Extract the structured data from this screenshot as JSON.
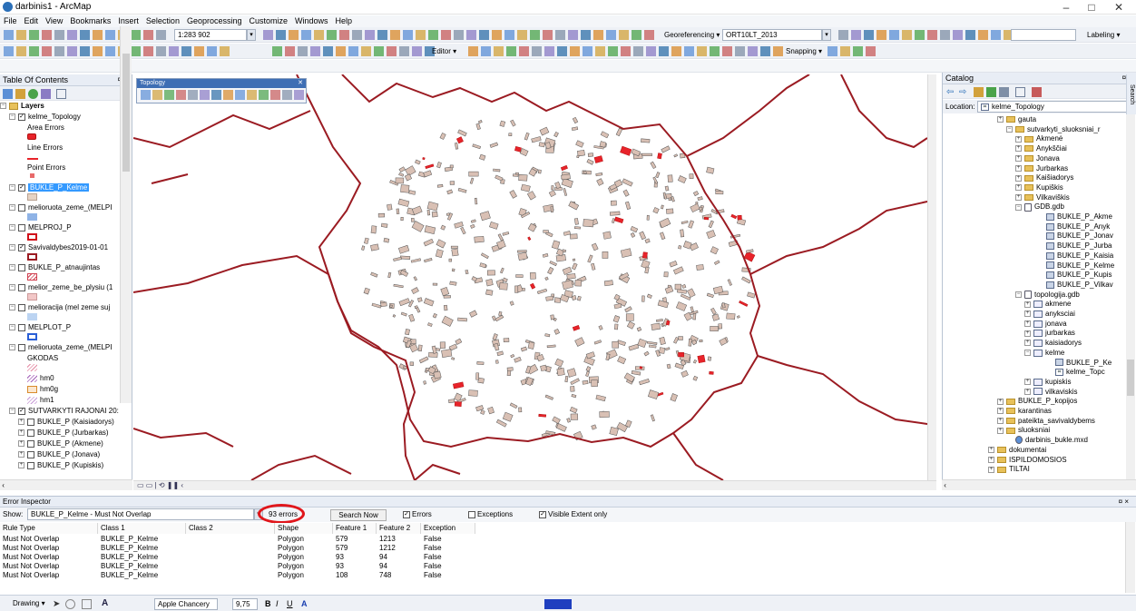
{
  "window": {
    "title": "darbinis1 - ArcMap",
    "controls": [
      "–",
      "□",
      "✕"
    ]
  },
  "menu": [
    "File",
    "Edit",
    "View",
    "Bookmarks",
    "Insert",
    "Selection",
    "Geoprocessing",
    "Customize",
    "Windows",
    "Help"
  ],
  "toolbars": {
    "scale": "1:283 902",
    "georeferencing_label": "Georeferencing ▾",
    "georeferencing_layer": "ORT10LT_2013",
    "labeling_label": "Labeling ▾",
    "editor_label": "Editor ▾",
    "snapping_label": "Snapping ▾"
  },
  "toc": {
    "title": "Table Of Contents",
    "pin": "¤ ×",
    "rows": [
      {
        "indent": 0,
        "exp": "−",
        "icon": "layers",
        "check": null,
        "label": "Layers",
        "bold": true
      },
      {
        "indent": 10,
        "exp": "−",
        "icon": null,
        "check": "✓",
        "label": "kelme_Topology"
      },
      {
        "indent": 30,
        "exp": null,
        "icon": null,
        "check": null,
        "label": "Area Errors"
      },
      {
        "indent": 30,
        "exp": null,
        "icon": null,
        "check": null,
        "label": "",
        "swatch": "area-error"
      },
      {
        "indent": 30,
        "exp": null,
        "icon": null,
        "check": null,
        "label": "Line Errors"
      },
      {
        "indent": 30,
        "exp": null,
        "icon": null,
        "check": null,
        "label": "",
        "swatch": "line-error"
      },
      {
        "indent": 30,
        "exp": null,
        "icon": null,
        "check": null,
        "label": "Point Errors"
      },
      {
        "indent": 30,
        "exp": null,
        "icon": null,
        "check": null,
        "label": "",
        "swatch": "point-error"
      },
      {
        "indent": 10,
        "exp": "−",
        "icon": null,
        "check": "✓",
        "label": "BUKLE_P_Kelme",
        "selected": true
      },
      {
        "indent": 30,
        "exp": null,
        "icon": null,
        "check": null,
        "label": "",
        "swatch": "bukle"
      },
      {
        "indent": 10,
        "exp": "−",
        "icon": null,
        "check": "",
        "label": "melioruota_zeme_(MELPI"
      },
      {
        "indent": 30,
        "exp": null,
        "icon": null,
        "check": null,
        "label": "",
        "swatch": "blue-fill"
      },
      {
        "indent": 10,
        "exp": "−",
        "icon": null,
        "check": "",
        "label": "MELPROJ_P"
      },
      {
        "indent": 30,
        "exp": null,
        "icon": null,
        "check": null,
        "label": "",
        "swatch": "red-outline"
      },
      {
        "indent": 10,
        "exp": "−",
        "icon": null,
        "check": "✓",
        "label": "Savivaldybes2019-01-01"
      },
      {
        "indent": 30,
        "exp": null,
        "icon": null,
        "check": null,
        "label": "",
        "swatch": "darkred-outline"
      },
      {
        "indent": 10,
        "exp": "−",
        "icon": null,
        "check": "",
        "label": "BUKLE_P_atnaujintas"
      },
      {
        "indent": 30,
        "exp": null,
        "icon": null,
        "check": null,
        "label": "",
        "swatch": "hatch-red"
      },
      {
        "indent": 10,
        "exp": "−",
        "icon": null,
        "check": "",
        "label": "melior_zeme_be_plysiu (1"
      },
      {
        "indent": 30,
        "exp": null,
        "icon": null,
        "check": null,
        "label": "",
        "swatch": "pink-fill"
      },
      {
        "indent": 10,
        "exp": "−",
        "icon": null,
        "check": "",
        "label": "melioracija (mel zeme suj"
      },
      {
        "indent": 30,
        "exp": null,
        "icon": null,
        "check": null,
        "label": "",
        "swatch": "lightblue-fill"
      },
      {
        "indent": 10,
        "exp": "−",
        "icon": null,
        "check": "",
        "label": "MELPLOT_P"
      },
      {
        "indent": 30,
        "exp": null,
        "icon": null,
        "check": null,
        "label": "",
        "swatch": "blue-outline"
      },
      {
        "indent": 10,
        "exp": "−",
        "icon": null,
        "check": "",
        "label": "melioruota_zeme_(MELPI"
      },
      {
        "indent": 30,
        "exp": null,
        "icon": null,
        "check": null,
        "label": "GKODAS"
      },
      {
        "indent": 30,
        "exp": null,
        "icon": null,
        "check": null,
        "label": "",
        "swatch": "hatch-pink"
      },
      {
        "indent": 30,
        "exp": null,
        "icon": null,
        "check": null,
        "label": "hm0",
        "swatch_inline": "hatch-purple"
      },
      {
        "indent": 30,
        "exp": null,
        "icon": null,
        "check": null,
        "label": "hm0g",
        "swatch_inline": "orange-box"
      },
      {
        "indent": 30,
        "exp": null,
        "icon": null,
        "check": null,
        "label": "hm1",
        "swatch_inline": "hatch-light"
      },
      {
        "indent": 10,
        "exp": "−",
        "icon": null,
        "check": "✓",
        "label": "SUTVARKYTI RAJONAI 20:"
      },
      {
        "indent": 20,
        "exp": "+",
        "icon": null,
        "check": "",
        "label": "BUKLE_P (Kaisiadorys)"
      },
      {
        "indent": 20,
        "exp": "+",
        "icon": null,
        "check": "",
        "label": "BUKLE_P (Jurbarkas)"
      },
      {
        "indent": 20,
        "exp": "+",
        "icon": null,
        "check": "",
        "label": "BUKLE_P (Akmene)"
      },
      {
        "indent": 20,
        "exp": "+",
        "icon": null,
        "check": "",
        "label": "BUKLE_P (Jonava)"
      },
      {
        "indent": 20,
        "exp": "+",
        "icon": null,
        "check": "",
        "label": "BUKLE_P (Kupiskis)"
      }
    ]
  },
  "topology_toolbar": {
    "title": "Topology",
    "close": "✕"
  },
  "catalog": {
    "title": "Catalog",
    "pin": "¤ ×",
    "location_label": "Location:",
    "location_value": "kelme_Topology",
    "side_tab": "Search",
    "rows": [
      {
        "indent": 70,
        "exp": "+",
        "type": "folder",
        "label": "gauta"
      },
      {
        "indent": 80,
        "exp": "−",
        "type": "folder",
        "label": "sutvarkyti_sluoksniai_r"
      },
      {
        "indent": 90,
        "exp": "+",
        "type": "folder",
        "label": "Akmenė"
      },
      {
        "indent": 90,
        "exp": "+",
        "type": "folder",
        "label": "Anykščiai"
      },
      {
        "indent": 90,
        "exp": "+",
        "type": "folder",
        "label": "Jonava"
      },
      {
        "indent": 90,
        "exp": "+",
        "type": "folder",
        "label": "Jurbarkas"
      },
      {
        "indent": 90,
        "exp": "+",
        "type": "folder",
        "label": "Kaišiadorys"
      },
      {
        "indent": 90,
        "exp": "+",
        "type": "folder",
        "label": "Kupiškis"
      },
      {
        "indent": 90,
        "exp": "+",
        "type": "folder",
        "label": "Vilkaviškis"
      },
      {
        "indent": 90,
        "exp": "−",
        "type": "gdb",
        "label": "GDB.gdb"
      },
      {
        "indent": 114,
        "exp": null,
        "type": "fc",
        "label": "BUKLE_P_Akme"
      },
      {
        "indent": 114,
        "exp": null,
        "type": "fc",
        "label": "BUKLE_P_Anyk"
      },
      {
        "indent": 114,
        "exp": null,
        "type": "fc",
        "label": "BUKLE_P_Jonav"
      },
      {
        "indent": 114,
        "exp": null,
        "type": "fc",
        "label": "BUKLE_P_Jurba"
      },
      {
        "indent": 114,
        "exp": null,
        "type": "fc",
        "label": "BUKLE_P_Kaisia"
      },
      {
        "indent": 114,
        "exp": null,
        "type": "fc",
        "label": "BUKLE_P_Kelme"
      },
      {
        "indent": 114,
        "exp": null,
        "type": "fc",
        "label": "BUKLE_P_Kupis"
      },
      {
        "indent": 114,
        "exp": null,
        "type": "fc",
        "label": "BUKLE_P_Vilkav"
      },
      {
        "indent": 90,
        "exp": "−",
        "type": "gdb",
        "label": "topologija.gdb"
      },
      {
        "indent": 100,
        "exp": "+",
        "type": "ds",
        "label": "akmene"
      },
      {
        "indent": 100,
        "exp": "+",
        "type": "ds",
        "label": "anyksciai"
      },
      {
        "indent": 100,
        "exp": "+",
        "type": "ds",
        "label": "jonava"
      },
      {
        "indent": 100,
        "exp": "+",
        "type": "ds",
        "label": "jurbarkas"
      },
      {
        "indent": 100,
        "exp": "+",
        "type": "ds",
        "label": "kaisiadorys"
      },
      {
        "indent": 100,
        "exp": "−",
        "type": "ds",
        "label": "kelme"
      },
      {
        "indent": 124,
        "exp": null,
        "type": "fc",
        "label": "BUKLE_P_Ke"
      },
      {
        "indent": 124,
        "exp": null,
        "type": "topo",
        "label": "kelme_Topc"
      },
      {
        "indent": 100,
        "exp": "+",
        "type": "ds",
        "label": "kupiskis"
      },
      {
        "indent": 100,
        "exp": "+",
        "type": "ds",
        "label": "vilkaviskis"
      },
      {
        "indent": 70,
        "exp": "+",
        "type": "folder",
        "label": "BUKLE_P_kopijos"
      },
      {
        "indent": 70,
        "exp": "+",
        "type": "folder",
        "label": "karantinas"
      },
      {
        "indent": 70,
        "exp": "+",
        "type": "folder",
        "label": "pateikta_savivaldybems"
      },
      {
        "indent": 70,
        "exp": "+",
        "type": "folder",
        "label": "sluoksniai"
      },
      {
        "indent": 80,
        "exp": null,
        "type": "mxd",
        "label": "darbinis_bukle.mxd"
      },
      {
        "indent": 60,
        "exp": "+",
        "type": "folder",
        "label": "dokumentai"
      },
      {
        "indent": 60,
        "exp": "+",
        "type": "folder",
        "label": "ISPILDOMOSIOS"
      },
      {
        "indent": 60,
        "exp": "+",
        "type": "folder",
        "label": "TILTAI"
      }
    ]
  },
  "error_inspector": {
    "title": "Error Inspector",
    "pin": "¤ ×",
    "show_label": "Show:",
    "show_value": "BUKLE_P_Kelme - Must Not Overlap",
    "error_count": "93 errors",
    "search_button": "Search Now",
    "errors_label": "Errors",
    "exceptions_label": "Exceptions",
    "visible_extent_label": "Visible Extent only",
    "errors_checked": true,
    "exceptions_checked": false,
    "visible_extent_checked": true,
    "columns": [
      "Rule Type",
      "Class 1",
      "Class 2",
      "Shape",
      "Feature 1",
      "Feature 2",
      "Exception"
    ],
    "rows": [
      [
        "Must Not Overlap",
        "BUKLE_P_Kelme",
        "",
        "Polygon",
        "579",
        "1213",
        "False"
      ],
      [
        "Must Not Overlap",
        "BUKLE_P_Kelme",
        "",
        "Polygon",
        "579",
        "1212",
        "False"
      ],
      [
        "Must Not Overlap",
        "BUKLE_P_Kelme",
        "",
        "Polygon",
        "93",
        "94",
        "False"
      ],
      [
        "Must Not Overlap",
        "BUKLE_P_Kelme",
        "",
        "Polygon",
        "93",
        "94",
        "False"
      ],
      [
        "Must Not Overlap",
        "BUKLE_P_Kelme",
        "",
        "Polygon",
        "108",
        "748",
        "False"
      ]
    ],
    "highlight_color": "#e0161b"
  },
  "drawing_toolbar": {
    "drawing_label": "Drawing ▾",
    "font": "Apple Chancery",
    "font_size": "9,75"
  },
  "map": {
    "boundary_color": "#9b1b22",
    "parcel_fill": "#d9c0b4",
    "error_fill": "#e8232a"
  }
}
